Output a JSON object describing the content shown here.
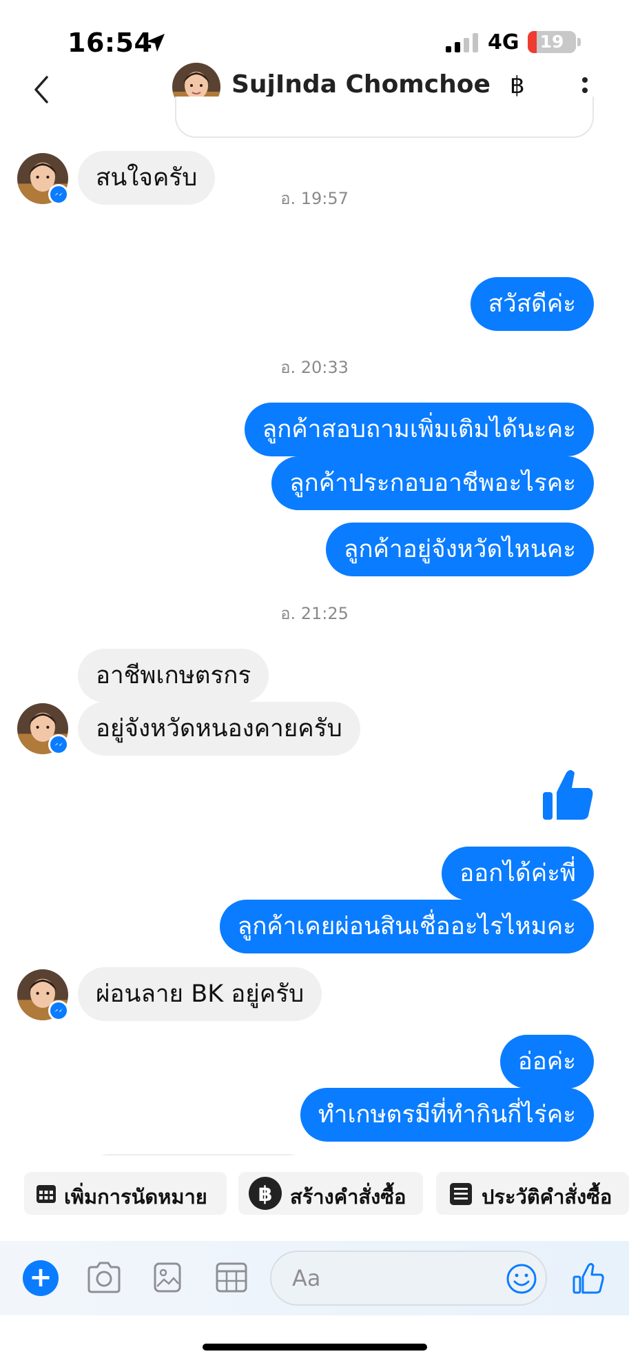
{
  "status_bar": {
    "time": "16:54",
    "network": "4G",
    "battery": "19",
    "battery_level": 0.19,
    "icons": [
      "location-arrow-icon",
      "cellular-signal-icon",
      "battery-icon"
    ]
  },
  "header": {
    "back_icon": "chevron-left-icon",
    "contact_name": "SujInda Chomchoe",
    "currency_icon": "฿",
    "more_icon": "vertical-dots-icon"
  },
  "messages": [
    {
      "direction": "in",
      "text": "สนใจครับ"
    },
    {
      "timestamp": "อ. 19:57"
    },
    {
      "direction": "out",
      "text": "สวัสดีค่ะ"
    },
    {
      "timestamp": "อ. 20:33"
    },
    {
      "direction": "out",
      "text": "ลูกค้าสอบถามเพิ่มเติมได้นะคะ"
    },
    {
      "direction": "out",
      "text": "ลูกค้าประกอบอาชีพอะไรคะ"
    },
    {
      "direction": "out",
      "text": "ลูกค้าอยู่จังหวัดไหนคะ"
    },
    {
      "timestamp": "อ. 21:25"
    },
    {
      "direction": "in",
      "text": "อาชีพเกษตรกร"
    },
    {
      "direction": "in",
      "text": "อยู่จังหวัดหนองคายครับ"
    },
    {
      "direction": "out",
      "type": "like",
      "icon": "thumbs-up-icon"
    },
    {
      "direction": "out",
      "text": "ออกได้ค่ะพี่"
    },
    {
      "direction": "out",
      "text": "ลูกค้าเคยผ่อนสินเชื่ออะไรไหมคะ"
    },
    {
      "direction": "in",
      "text": "ผ่อนลาย BK อยู่ครับ"
    },
    {
      "direction": "out",
      "text": "อ่อค่ะ"
    },
    {
      "direction": "out",
      "text": "ทำเกษตรมีที่ทำกินกี่ไร่คะ"
    }
  ],
  "quick_actions": [
    {
      "label": "เพิ่มการนัดหมาย",
      "icon": "calendar-grid-icon"
    },
    {
      "label": "สร้างคำสั่งซื้อ",
      "icon": "baht-circle-icon"
    },
    {
      "label": "ประวัติคำสั่งซื้อ",
      "icon": "receipt-list-icon"
    }
  ],
  "composer": {
    "placeholder": "Aa",
    "icons": [
      "plus-icon",
      "camera-icon",
      "image-icon",
      "calendar-grid-icon",
      "emoji-icon",
      "thumbs-up-icon"
    ]
  },
  "colors": {
    "outgoing_bubble": "#0a7cff",
    "incoming_bubble": "#f0f0f0",
    "timestamp": "#8a8a8a",
    "battery_low": "#ef3b30"
  }
}
